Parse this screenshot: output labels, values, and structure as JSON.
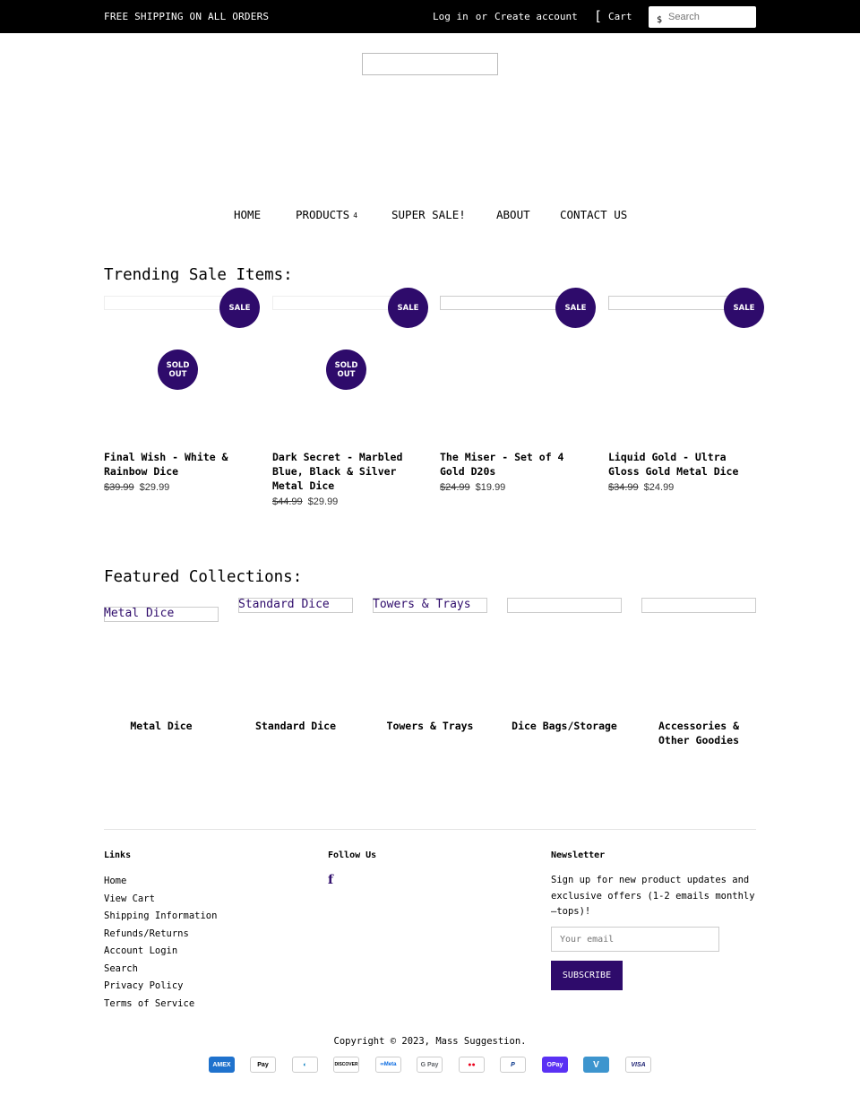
{
  "topbar": {
    "promo": "FREE SHIPPING ON ALL ORDERS",
    "login": "Log in",
    "or": "or",
    "create_account": "Create account",
    "cart_icon": "[",
    "cart": "Cart",
    "search_icon": "$",
    "search_placeholder": "Search"
  },
  "nav": {
    "home": "HOME",
    "products": "PRODUCTS",
    "products_caret": "4",
    "super_sale": "SUPER SALE!",
    "about": "ABOUT",
    "contact": "CONTACT US"
  },
  "trending_title": "Trending Sale Items:",
  "badges": {
    "sale": "SALE",
    "sold_out_1": "SOLD",
    "sold_out_2": "OUT"
  },
  "products": [
    {
      "title": "Final Wish - White & Rainbow Dice",
      "was": "$39.99",
      "now": "$29.99"
    },
    {
      "title": "Dark Secret - Marbled Blue, Black & Silver Metal Dice",
      "was": "$44.99",
      "now": "$29.99"
    },
    {
      "title": "The Miser - Set of 4 Gold D20s",
      "was": "$24.99",
      "now": "$19.99"
    },
    {
      "title": "Liquid Gold - Ultra Gloss Gold Metal Dice",
      "was": "$34.99",
      "now": "$24.99"
    }
  ],
  "featured_title": "Featured Collections:",
  "collections": [
    {
      "alt": "Metal Dice",
      "name": "Metal Dice"
    },
    {
      "alt": "Standard Dice",
      "name": "Standard Dice"
    },
    {
      "alt": "Towers & Trays",
      "name": "Towers & Trays"
    },
    {
      "alt": "",
      "name": "Dice Bags/Storage"
    },
    {
      "alt": "",
      "name": "Accessories & Other Goodies"
    }
  ],
  "footer": {
    "links_heading": "Links",
    "links": [
      "Home",
      "View Cart",
      "Shipping Information",
      "Refunds/Returns",
      "Account Login",
      "Search",
      "Privacy Policy",
      "Terms of Service"
    ],
    "follow_heading": "Follow Us",
    "facebook_glyph": "f",
    "newsletter_heading": "Newsletter",
    "newsletter_text": "Sign up for new product updates and exclusive offers (1-2 emails monthly—tops)!",
    "email_placeholder": "Your email",
    "subscribe": "SUBSCRIBE",
    "copyright": "Copyright © 2023, Mass Suggestion."
  },
  "payments": [
    {
      "icon": "amex-icon",
      "label": "AMEX",
      "bg": "#1f72cd",
      "fg": "#ffffff"
    },
    {
      "icon": "apple-pay-icon",
      "label": "Pay",
      "bg": "#ffffff",
      "fg": "#000000"
    },
    {
      "icon": "diners-club-icon",
      "label": "◐",
      "bg": "#ffffff",
      "fg": "#0079be"
    },
    {
      "icon": "discover-icon",
      "label": "DISCOVER",
      "bg": "#ffffff",
      "fg": "#000000"
    },
    {
      "icon": "meta-pay-icon",
      "label": "∞Meta",
      "bg": "#ffffff",
      "fg": "#0a6be1"
    },
    {
      "icon": "google-pay-icon",
      "label": "G Pay",
      "bg": "#ffffff",
      "fg": "#5f6368"
    },
    {
      "icon": "mastercard-icon",
      "label": "●●",
      "bg": "#ffffff",
      "fg": "#eb001b"
    },
    {
      "icon": "paypal-icon",
      "label": "P",
      "bg": "#ffffff",
      "fg": "#003087"
    },
    {
      "icon": "shop-pay-icon",
      "label": "OPay",
      "bg": "#5a31f4",
      "fg": "#ffffff"
    },
    {
      "icon": "venmo-icon",
      "label": "V",
      "bg": "#3d95ce",
      "fg": "#ffffff"
    },
    {
      "icon": "visa-icon",
      "label": "VISA",
      "bg": "#ffffff",
      "fg": "#1a1f71"
    }
  ]
}
